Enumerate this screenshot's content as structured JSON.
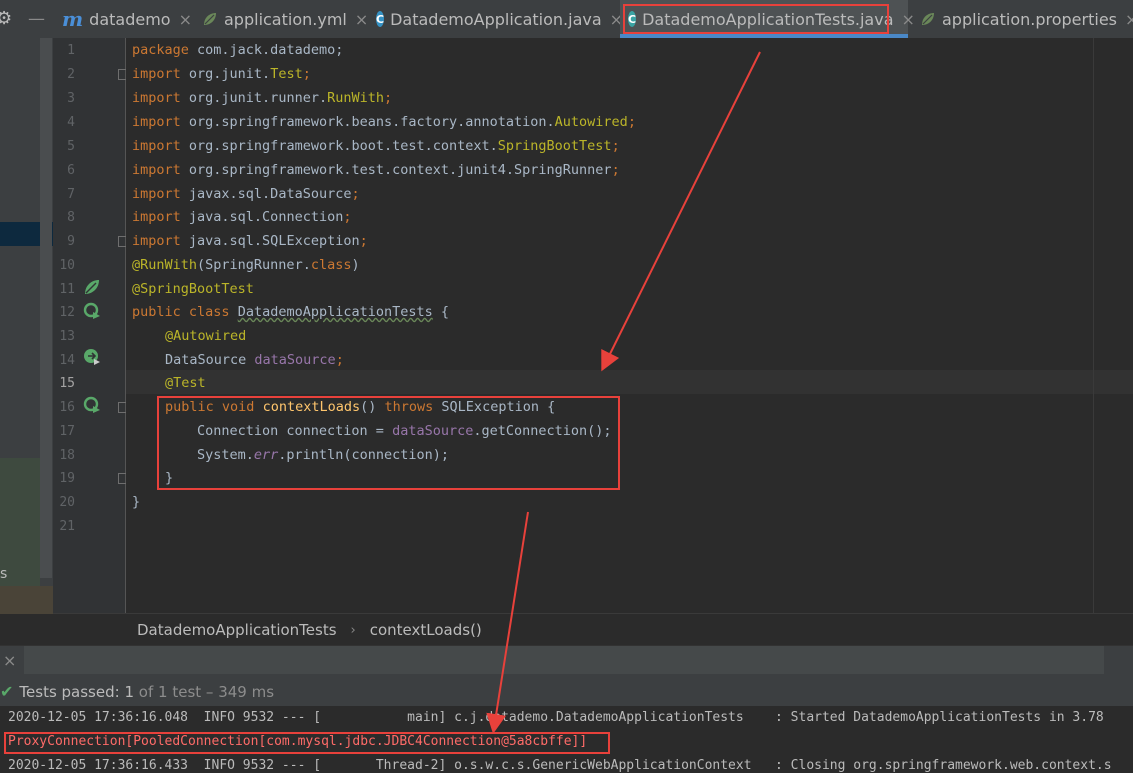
{
  "tabs": [
    {
      "label": "datademo",
      "icon": "module-icon"
    },
    {
      "label": "application.yml",
      "icon": "spring-config-icon"
    },
    {
      "label": "DatademoApplication.java",
      "icon": "java-class-icon"
    },
    {
      "label": "DatademoApplicationTests.java",
      "icon": "java-test-class-icon",
      "active": true
    },
    {
      "label": "application.properties",
      "icon": "spring-config-icon"
    }
  ],
  "gear_icon": "⚙",
  "close_glyph": "×",
  "line_numbers": [
    "1",
    "2",
    "3",
    "4",
    "5",
    "6",
    "7",
    "8",
    "9",
    "10",
    "11",
    "12",
    "13",
    "14",
    "15",
    "16",
    "17",
    "18",
    "19",
    "20",
    "21"
  ],
  "code": {
    "l1": {
      "kw": "package",
      "rest": " com.jack.datademo;"
    },
    "l2": {
      "kw": "import",
      "a": " org.junit.",
      "b": "Test",
      "c": ";"
    },
    "l3": {
      "kw": "import",
      "a": " org.junit.runner.",
      "b": "RunWith",
      "c": ";"
    },
    "l4": {
      "kw": "import",
      "a": " org.springframework.beans.factory.annotation.",
      "b": "Autowired",
      "c": ";"
    },
    "l5": {
      "kw": "import",
      "a": " org.springframework.boot.test.context.",
      "b": "SpringBootTest",
      "c": ";"
    },
    "l6": {
      "kw": "import",
      "a": " org.springframework.test.context.junit4.SpringRunner",
      "c": ";"
    },
    "l7": {
      "kw": "import",
      "a": " javax.sql.DataSource",
      "c": ";"
    },
    "l8": {
      "kw": "import",
      "a": " java.sql.Connection",
      "c": ";"
    },
    "l9": {
      "kw": "import",
      "a": " java.sql.SQLException",
      "c": ";"
    },
    "l10": {
      "an": "@RunWith",
      "a": "(SpringRunner.",
      "kw": "class",
      "c": ")"
    },
    "l11": {
      "an": "@SpringBootTest"
    },
    "l12": {
      "kw1": "public",
      "kw2": "class",
      "a": "DatademoApplicationTests",
      "c": " {"
    },
    "l13": {
      "an": "@Autowired"
    },
    "l14": {
      "a": "DataSource ",
      "fld": "dataSource",
      "c": ";"
    },
    "l15": {
      "an": "@Test"
    },
    "l16": {
      "kw1": "public",
      "kw2": "void",
      "fn": "contextLoads",
      "a": "() ",
      "kw3": "throws",
      "c": " SQLException {"
    },
    "l17": {
      "a": "Connection connection = ",
      "fld": "dataSource",
      "c": ".getConnection();"
    },
    "l18": {
      "a": "System.",
      "fld": "err",
      "c": ".println(connection);"
    },
    "l19": {
      "a": "}"
    },
    "l20": {
      "a": "}"
    }
  },
  "breadcrumb": {
    "class": "DatademoApplicationTests",
    "method": "contextLoads()",
    "separator": "›"
  },
  "run": {
    "status_prefix": "Tests passed:",
    "status_count": "1",
    "status_rest": "of 1 test",
    "status_time": "– 349 ms",
    "console": [
      "2020-12-05 17:36:16.048  INFO 9532 --- [           main] c.j.datademo.DatademoApplicationTests    : Started DatademoApplicationTests in 3.78",
      "ProxyConnection[PooledConnection[com.mysql.jdbc.JDBC4Connection@5a8cbffe]]",
      "2020-12-05 17:36:16.433  INFO 9532 --- [       Thread-2] o.s.w.c.s.GenericWebApplicationContext   : Closing org.springframework.web.context.s"
    ]
  },
  "left_panel_letter": "s",
  "colors": {
    "annotation_red": "#e8413b",
    "tab_underline": "#4a88c7",
    "success_green": "#59a869"
  }
}
